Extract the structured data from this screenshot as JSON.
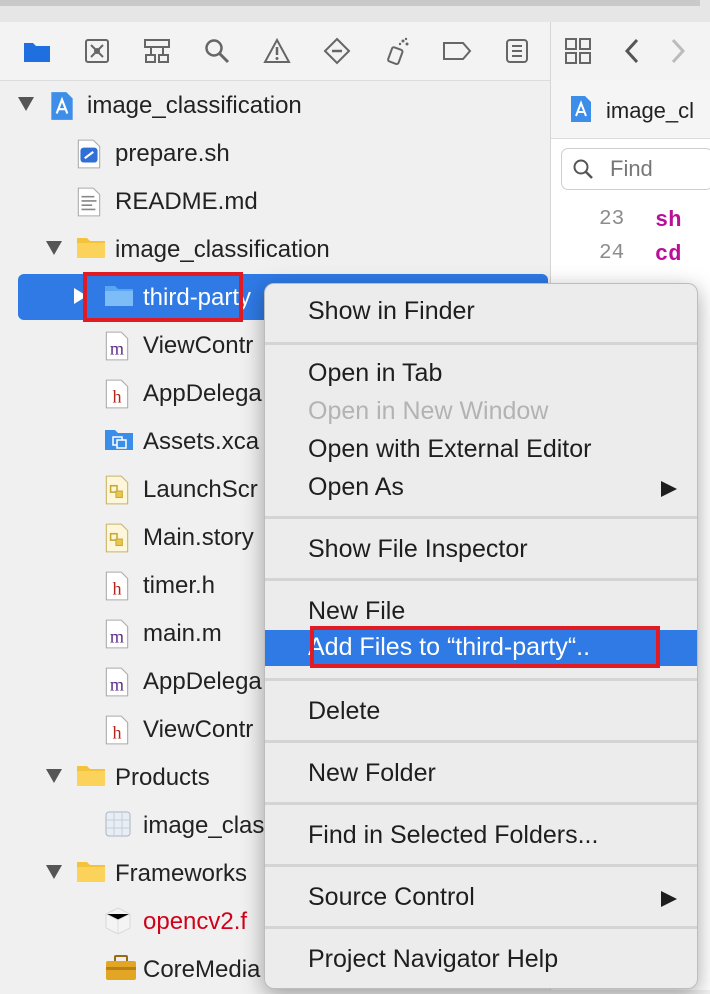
{
  "navigator": {
    "tree": [
      {
        "label": "image_classification",
        "icon": "xcode-project-icon",
        "level": 0,
        "disclosure": "down"
      },
      {
        "label": "prepare.sh",
        "icon": "shell-script-icon",
        "level": 1
      },
      {
        "label": "README.md",
        "icon": "text-file-icon",
        "level": 1
      },
      {
        "label": "image_classification",
        "icon": "folder-icon",
        "level": 1,
        "disclosure": "down"
      },
      {
        "label": "third-party",
        "icon": "folder-blue-icon",
        "level": 2,
        "disclosure": "right",
        "selected": true
      },
      {
        "label": "ViewContr",
        "icon": "m-file-icon",
        "level": 2
      },
      {
        "label": "AppDelega",
        "icon": "h-file-icon",
        "level": 2
      },
      {
        "label": "Assets.xca",
        "icon": "assets-folder-icon",
        "level": 2
      },
      {
        "label": "LaunchScr",
        "icon": "storyboard-icon",
        "level": 2
      },
      {
        "label": "Main.story",
        "icon": "storyboard-icon",
        "level": 2
      },
      {
        "label": "timer.h",
        "icon": "h-file-icon",
        "level": 2
      },
      {
        "label": "main.m",
        "icon": "m-file-icon",
        "level": 2
      },
      {
        "label": "AppDelega",
        "icon": "m-file-icon",
        "level": 2
      },
      {
        "label": "ViewContr",
        "icon": "h-file-icon",
        "level": 2
      },
      {
        "label": "Products",
        "icon": "folder-icon",
        "level": 1,
        "disclosure": "down"
      },
      {
        "label": "image_clas",
        "icon": "app-product-icon",
        "level": 2
      },
      {
        "label": "Frameworks",
        "icon": "folder-icon",
        "level": 1,
        "disclosure": "down"
      },
      {
        "label": "opencv2.f",
        "icon": "framework-missing-icon",
        "level": 2,
        "color": "#d0021b"
      },
      {
        "label": "CoreMedia",
        "icon": "toolbox-icon",
        "level": 2
      }
    ]
  },
  "editor": {
    "tab_title": "image_cl",
    "find_placeholder": "Find",
    "lines": [
      {
        "num": "23",
        "code": "sh"
      },
      {
        "num": "24",
        "code": "cd"
      }
    ]
  },
  "context_menu": {
    "items": [
      {
        "label": "Show in Finder"
      },
      {
        "separator": true
      },
      {
        "label": "Open in Tab"
      },
      {
        "label": "Open in New Window",
        "disabled": true
      },
      {
        "label": "Open with External Editor"
      },
      {
        "label": "Open As",
        "submenu": true
      },
      {
        "separator": true
      },
      {
        "label": "Show File Inspector"
      },
      {
        "separator": true
      },
      {
        "label": "New File"
      },
      {
        "label": "Add Files to “third-party“..",
        "highlighted": true
      },
      {
        "separator": true
      },
      {
        "label": "Delete"
      },
      {
        "separator": true
      },
      {
        "label": "New Folder"
      },
      {
        "separator": true
      },
      {
        "label": "Find in Selected Folders..."
      },
      {
        "separator": true
      },
      {
        "label": "Source Control",
        "submenu": true
      },
      {
        "separator": true
      },
      {
        "label": "Project Navigator Help"
      }
    ]
  },
  "colors": {
    "selection": "#2f7ae5",
    "annotation_red": "#e01b24",
    "missing_file_red": "#d0021b",
    "folder_yellow": "#f5c33b",
    "folder_blue": "#5aa7f0"
  }
}
